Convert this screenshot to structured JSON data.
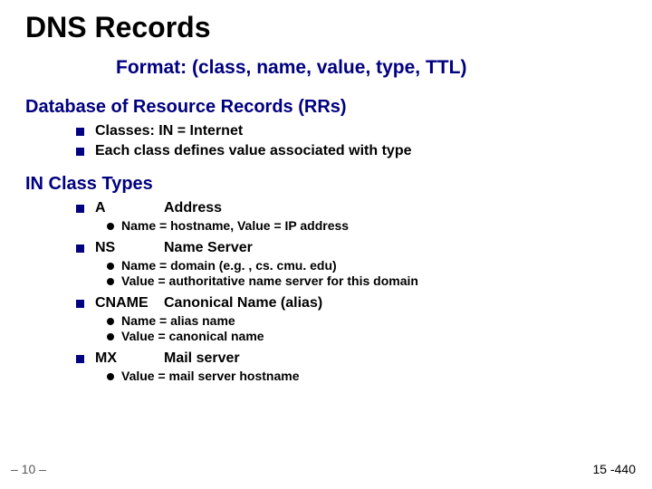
{
  "title": "DNS Records",
  "format_line": "Format: (class, name, value, type, TTL)",
  "section1": {
    "heading": "Database of Resource Records (RRs)",
    "bullets": [
      "Classes: IN = Internet",
      "Each class defines value associated with type"
    ]
  },
  "section2": {
    "heading": "IN Class Types",
    "types": [
      {
        "code": "A",
        "desc": "Address",
        "subs": [
          "Name = hostname, Value = IP address"
        ]
      },
      {
        "code": "NS",
        "desc": "Name Server",
        "subs": [
          "Name = domain (e.g. , cs. cmu. edu)",
          "Value = authoritative name server for this domain"
        ]
      },
      {
        "code": "CNAME",
        "desc": "Canonical Name (alias)",
        "subs": [
          "Name = alias name",
          "Value = canonical name"
        ]
      },
      {
        "code": "MX",
        "desc": "Mail server",
        "subs": [
          "Value = mail server hostname"
        ]
      }
    ]
  },
  "page_num": "– 10 –",
  "course_num": "15 -440"
}
